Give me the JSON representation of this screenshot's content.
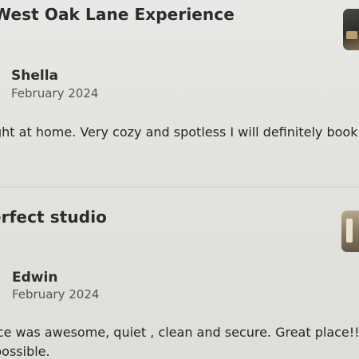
{
  "reviews": [
    {
      "title": "West Oak Lane Experience",
      "reviewer": "Shella",
      "date": "February 2024",
      "body": "ght at home. Very cozy and spotless I will definitely book",
      "thumbnail_icon": "listing-photo-icon"
    },
    {
      "title": "erfect studio",
      "reviewer": "Edwin",
      "date": "February 2024",
      "body": "ace was awesome, quiet , clean and secure. Great place!!",
      "body_line2": "possible.",
      "thumbnail_icon": "listing-photo-icon"
    }
  ],
  "colors": {
    "background": "#e4e4e2",
    "title_text": "#2b2b2b",
    "date_text": "#555555",
    "divider": "#c9c9c6"
  }
}
